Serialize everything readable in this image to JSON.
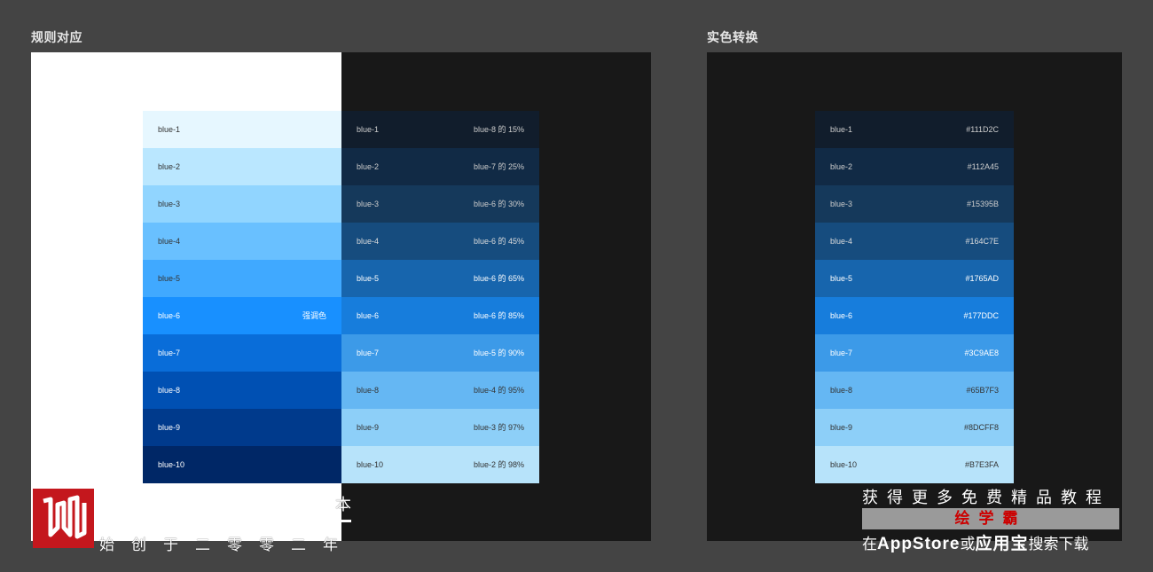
{
  "left_section": {
    "title": "规则对应"
  },
  "right_section": {
    "title": "实色转换"
  },
  "light_palette": [
    {
      "name": "blue-1",
      "color": "#E6F7FF",
      "text_color": "#333333",
      "note": ""
    },
    {
      "name": "blue-2",
      "color": "#BAE7FF",
      "text_color": "#333333",
      "note": ""
    },
    {
      "name": "blue-3",
      "color": "#91D5FF",
      "text_color": "#333333",
      "note": ""
    },
    {
      "name": "blue-4",
      "color": "#69C0FF",
      "text_color": "#333333",
      "note": ""
    },
    {
      "name": "blue-5",
      "color": "#40A9FF",
      "text_color": "#333333",
      "note": ""
    },
    {
      "name": "blue-6",
      "color": "#1890FF",
      "text_color": "#FFFFFF",
      "note": "强调色"
    },
    {
      "name": "blue-7",
      "color": "#096DD9",
      "text_color": "#FFFFFF",
      "note": ""
    },
    {
      "name": "blue-8",
      "color": "#0050B3",
      "text_color": "#FFFFFF",
      "note": ""
    },
    {
      "name": "blue-9",
      "color": "#003A8C",
      "text_color": "#FFFFFF",
      "note": ""
    },
    {
      "name": "blue-10",
      "color": "#002766",
      "text_color": "#FFFFFF",
      "note": ""
    }
  ],
  "dark_palette": [
    {
      "name": "blue-1",
      "rule": "blue-8 的 15%",
      "color": "#111D2C",
      "text_color": "#CCCCCC"
    },
    {
      "name": "blue-2",
      "rule": "blue-7 的 25%",
      "color": "#112A45",
      "text_color": "#CCCCCC"
    },
    {
      "name": "blue-3",
      "rule": "blue-6 的 30%",
      "color": "#15395B",
      "text_color": "#CCCCCC"
    },
    {
      "name": "blue-4",
      "rule": "blue-6 的 45%",
      "color": "#164C7E",
      "text_color": "#DDDDDD"
    },
    {
      "name": "blue-5",
      "rule": "blue-6 的 65%",
      "color": "#1765AD",
      "text_color": "#FFFFFF"
    },
    {
      "name": "blue-6",
      "rule": "blue-6 的 85%",
      "color": "#177DDC",
      "text_color": "#FFFFFF"
    },
    {
      "name": "blue-7",
      "rule": "blue-5 的 90%",
      "color": "#3C9AE8",
      "text_color": "#FFFFFF"
    },
    {
      "name": "blue-8",
      "rule": "blue-4 的 95%",
      "color": "#65B7F3",
      "text_color": "#333333"
    },
    {
      "name": "blue-9",
      "rule": "blue-3 的 97%",
      "color": "#8DCFF8",
      "text_color": "#333333"
    },
    {
      "name": "blue-10",
      "rule": "blue-2 的 98%",
      "color": "#B7E3FA",
      "text_color": "#333333"
    }
  ],
  "real_palette": [
    {
      "name": "blue-1",
      "hex": "#111D2C",
      "color": "#111D2C",
      "text_color": "#CCCCCC"
    },
    {
      "name": "blue-2",
      "hex": "#112A45",
      "color": "#112A45",
      "text_color": "#CCCCCC"
    },
    {
      "name": "blue-3",
      "hex": "#15395B",
      "color": "#15395B",
      "text_color": "#CCCCCC"
    },
    {
      "name": "blue-4",
      "hex": "#164C7E",
      "color": "#164C7E",
      "text_color": "#DDDDDD"
    },
    {
      "name": "blue-5",
      "hex": "#1765AD",
      "color": "#1765AD",
      "text_color": "#FFFFFF"
    },
    {
      "name": "blue-6",
      "hex": "#177DDC",
      "color": "#177DDC",
      "text_color": "#FFFFFF"
    },
    {
      "name": "blue-7",
      "hex": "#3C9AE8",
      "color": "#3C9AE8",
      "text_color": "#FFFFFF"
    },
    {
      "name": "blue-8",
      "hex": "#65B7F3",
      "color": "#65B7F3",
      "text_color": "#333333"
    },
    {
      "name": "blue-9",
      "hex": "#8DCFF8",
      "color": "#8DCFF8",
      "text_color": "#333333"
    },
    {
      "name": "blue-10",
      "hex": "#B7E3FA",
      "color": "#B7E3FA",
      "text_color": "#333333"
    }
  ],
  "watermark_left": {
    "line1": "本",
    "line2": "始创于二零零二年",
    "logo_icon": "huixueba-logo-icon",
    "logo_color": "#C4171D"
  },
  "watermark_right": {
    "line1": "获得更多免费精品教程",
    "line2": "绘学霸",
    "line3_prefix": "在",
    "line3_app": "AppStore",
    "line3_mid": "或",
    "line3_store": "应用宝",
    "line3_suffix": "搜索下载"
  }
}
